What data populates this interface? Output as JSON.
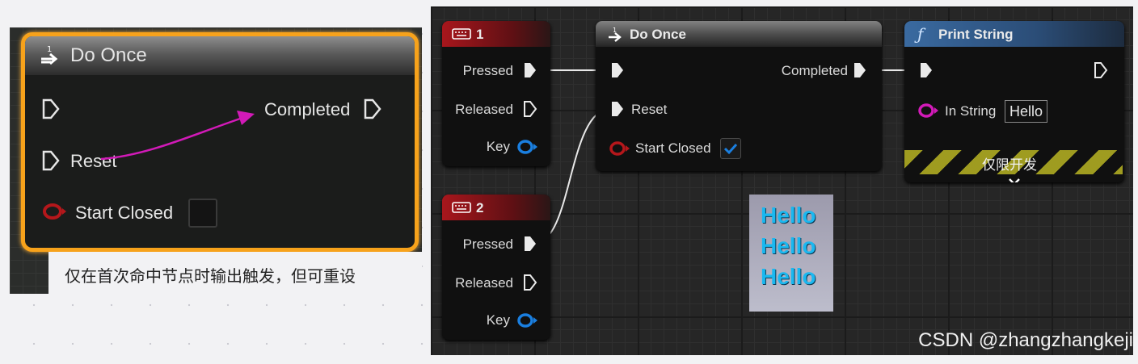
{
  "left": {
    "node_title": "Do Once",
    "pins": {
      "completed": "Completed",
      "reset": "Reset",
      "start_closed": "Start Closed"
    },
    "caption": "仅在首次命中节点时输出触发，但可重设"
  },
  "right": {
    "key_nodes": [
      {
        "title": "1",
        "pressed": "Pressed",
        "released": "Released",
        "key": "Key"
      },
      {
        "title": "2",
        "pressed": "Pressed",
        "released": "Released",
        "key": "Key"
      }
    ],
    "do_once": {
      "title": "Do Once",
      "completed": "Completed",
      "reset": "Reset",
      "start_closed": "Start Closed",
      "start_closed_checked": true
    },
    "print_string": {
      "title": "Print String",
      "in_string_label": "In String",
      "in_string_value": "Hello",
      "dev_only": "仅限开发"
    },
    "hello_output": [
      "Hello",
      "Hello",
      "Hello"
    ],
    "watermark": "CSDN @zhangzhangkeji"
  },
  "colors": {
    "accent_orange": "#f7a21b",
    "wire_magenta": "#d21ab8",
    "pin_red": "#b5171b",
    "pin_blue": "#1a7fe0",
    "check_blue": "#1a7fe0"
  }
}
